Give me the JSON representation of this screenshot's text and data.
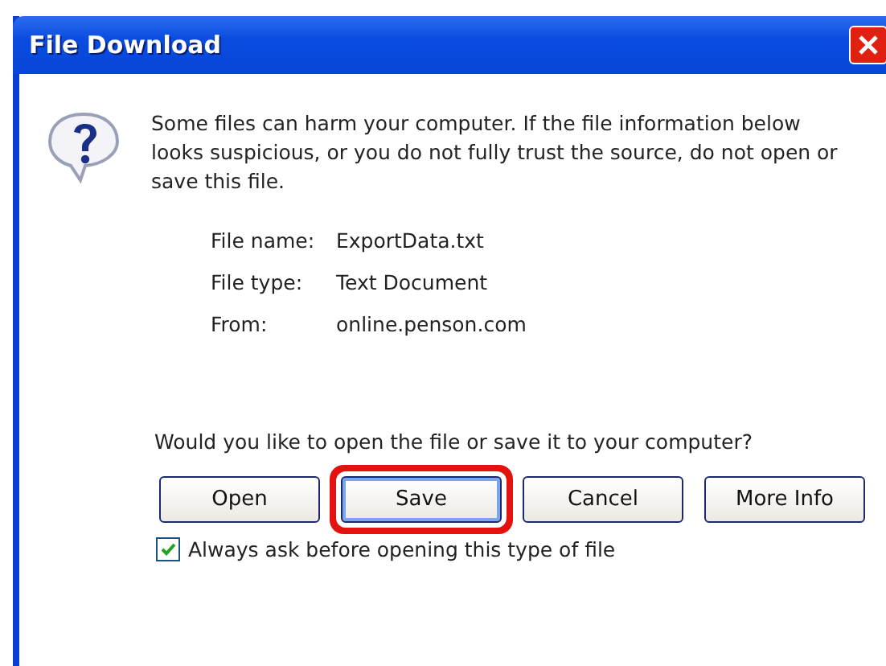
{
  "window": {
    "title": "File Download"
  },
  "message": "Some files can harm your computer. If the file information below looks suspicious, or you do not fully trust the source, do not open or save this file.",
  "file_info": [
    {
      "label": "File name:",
      "value": "ExportData.txt"
    },
    {
      "label": "File type:",
      "value": "Text Document"
    },
    {
      "label": "From:",
      "value": "online.penson.com"
    }
  ],
  "question": "Would you like to open the file or save it to your computer?",
  "buttons": [
    {
      "label": "Open",
      "highlighted": false
    },
    {
      "label": "Save",
      "highlighted": true
    },
    {
      "label": "Cancel",
      "highlighted": false
    },
    {
      "label": "More Info",
      "highlighted": false
    }
  ],
  "checkbox": {
    "label": "Always ask before opening this type of file",
    "checked": true
  }
}
